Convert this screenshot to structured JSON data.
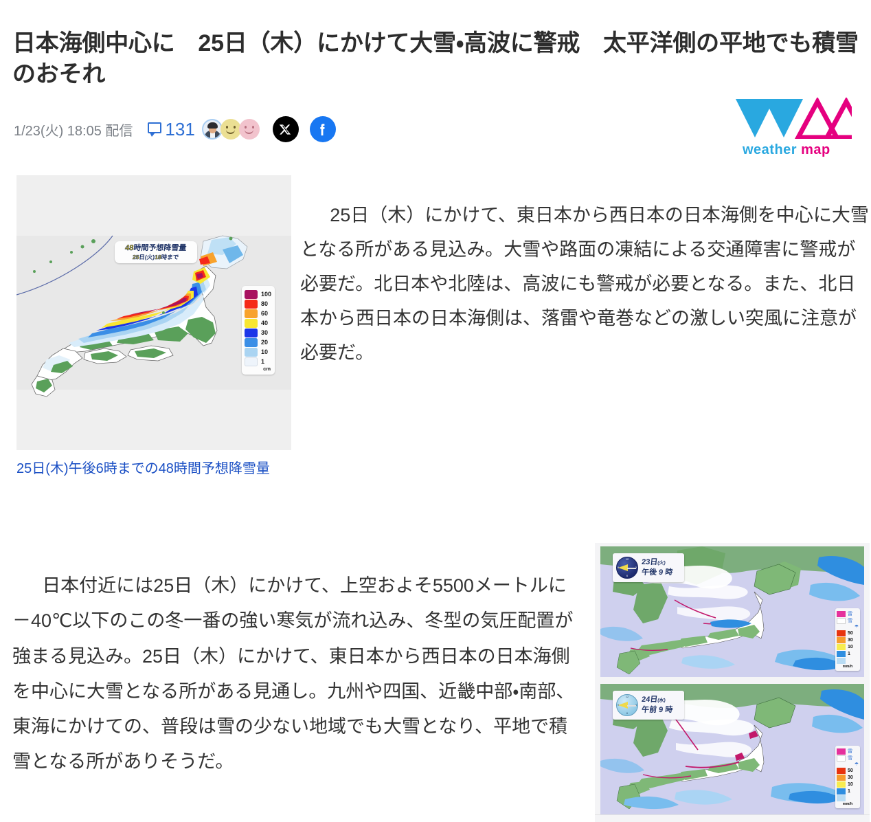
{
  "article": {
    "headline": "日本海側中心に　25日（木）にかけて大雪・高波に警戒　太平洋側の平地でも積雪のおそれ",
    "published": "1/23(火) 18:05 配信",
    "comment_count": "131",
    "paragraph_1": "25日（木）にかけて、東日本から西日本の日本海側を中心に大雪となる所がある見込み。大雪や路面の凍結による交通障害に警戒が必要だ。北日本や北陸は、高波にも警戒が必要となる。また、北日本から西日本の日本海側は、落雷や竜巻などの激しい突風に注意が必要だ。",
    "paragraph_2": "日本付近には25日（木）にかけて、上空およそ5500メートルに－40℃以下のこの冬一番の強い寒気が流れ込み、冬型の気圧配置が強まる見込み。25日（木）にかけて、東日本から西日本の日本海側を中心に大雪となる所がある見通し。九州や四国、近畿中部・南部、東海にかけての、普段は雪の少ない地域でも大雪となり、平地で積雪となる所がありそうだ。"
  },
  "brand": {
    "word_1": "weather",
    "word_2": "map",
    "color_cyan": "#29a8e0",
    "color_magenta": "#e5007f"
  },
  "share": {
    "x_label": "X",
    "facebook_label": "f"
  },
  "snow_figure": {
    "caption": "25日(木)午後6時までの48時間予想降雪量",
    "map_title_line1": "48時間予想降雪量",
    "map_title_num": "48",
    "map_title_text": "時間予想降雪量",
    "map_title_line2_num1": "25",
    "map_title_line2_mid": "日(火)",
    "map_title_line2_num2": "18",
    "map_title_line2_end": "時まで",
    "legend_unit": "cm",
    "legend": [
      {
        "label": "100",
        "color": "#a8115f"
      },
      {
        "label": "80",
        "color": "#f52a19"
      },
      {
        "label": "60",
        "color": "#f8a22c"
      },
      {
        "label": "40",
        "color": "#f8e632"
      },
      {
        "label": "30",
        "color": "#1b35e8"
      },
      {
        "label": "20",
        "color": "#3a8ee6"
      },
      {
        "label": "10",
        "color": "#aad4f2"
      },
      {
        "label": "1",
        "color": "#eef4fb"
      }
    ]
  },
  "forecast_maps": [
    {
      "day": "23日",
      "weekday": "(火)",
      "time": "午後 9 時",
      "clock_mode": "night"
    },
    {
      "day": "24日",
      "weekday": "(水)",
      "time": "午前 9 時",
      "clock_mode": "day"
    }
  ],
  "rain_legend": {
    "unit": "mm/h",
    "rows": [
      {
        "label": "雷",
        "color": "#e5319c",
        "is_icon": true
      },
      {
        "label": "雪",
        "color": "#ffffff",
        "is_icon": true
      },
      {
        "label": "50",
        "color": "#e8340f"
      },
      {
        "label": "30",
        "color": "#f79c2e"
      },
      {
        "label": "10",
        "color": "#f7ec50"
      },
      {
        "label": "1",
        "color": "#2f8ee0"
      },
      {
        "label": "",
        "color": "#b9dcf4"
      }
    ],
    "umbrella_icon": "☂"
  }
}
